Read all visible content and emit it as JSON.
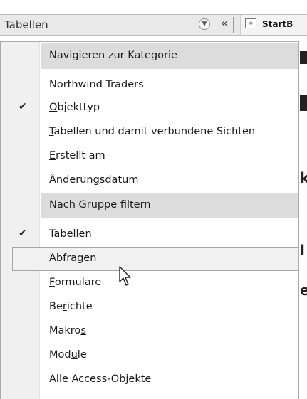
{
  "navbar": {
    "title": "Tabellen",
    "dropdown_glyph": "▼",
    "collapse_glyph": "«",
    "tab": {
      "label": "StartB",
      "icon": "form-icon"
    }
  },
  "menu": {
    "rows": [
      {
        "type": "header",
        "pre": "",
        "acc": "",
        "post": "Navigieren zur Kategorie"
      },
      {
        "type": "item",
        "pre": "Northwind Traders",
        "acc": "",
        "post": "",
        "checked": false
      },
      {
        "type": "item",
        "pre": "",
        "acc": "O",
        "post": "bjekttyp",
        "checked": true
      },
      {
        "type": "item",
        "pre": "",
        "acc": "T",
        "post": "abellen und damit verbundene Sichten",
        "checked": false
      },
      {
        "type": "item",
        "pre": "",
        "acc": "E",
        "post": "rstellt am",
        "checked": false
      },
      {
        "type": "item",
        "pre": "Änderun",
        "acc": "g",
        "post": "sdatum",
        "checked": false
      },
      {
        "type": "header",
        "pre": "",
        "acc": "",
        "post": "Nach Gruppe filtern"
      },
      {
        "type": "item",
        "pre": "Ta",
        "acc": "b",
        "post": "ellen",
        "checked": true
      },
      {
        "type": "item",
        "pre": "Abf",
        "acc": "r",
        "post": "agen",
        "checked": false,
        "hovered": true
      },
      {
        "type": "item",
        "pre": "",
        "acc": "F",
        "post": "ormulare",
        "checked": false
      },
      {
        "type": "item",
        "pre": "Be",
        "acc": "r",
        "post": "ichte",
        "checked": false
      },
      {
        "type": "item",
        "pre": "Makro",
        "acc": "s",
        "post": "",
        "checked": false
      },
      {
        "type": "item",
        "pre": "Mod",
        "acc": "u",
        "post": "le",
        "checked": false
      },
      {
        "type": "item",
        "pre": "",
        "acc": "A",
        "post": "lle Access-Objekte",
        "checked": false
      }
    ],
    "check_glyph": "✔"
  },
  "background_fragments": [
    "k",
    "l",
    "e"
  ],
  "colors": {
    "header_bg": "#dcdcdc",
    "gutter_bg": "#f0f0f0",
    "hover_bg": "#f1f1f1",
    "hover_border": "#a6a6a6"
  }
}
